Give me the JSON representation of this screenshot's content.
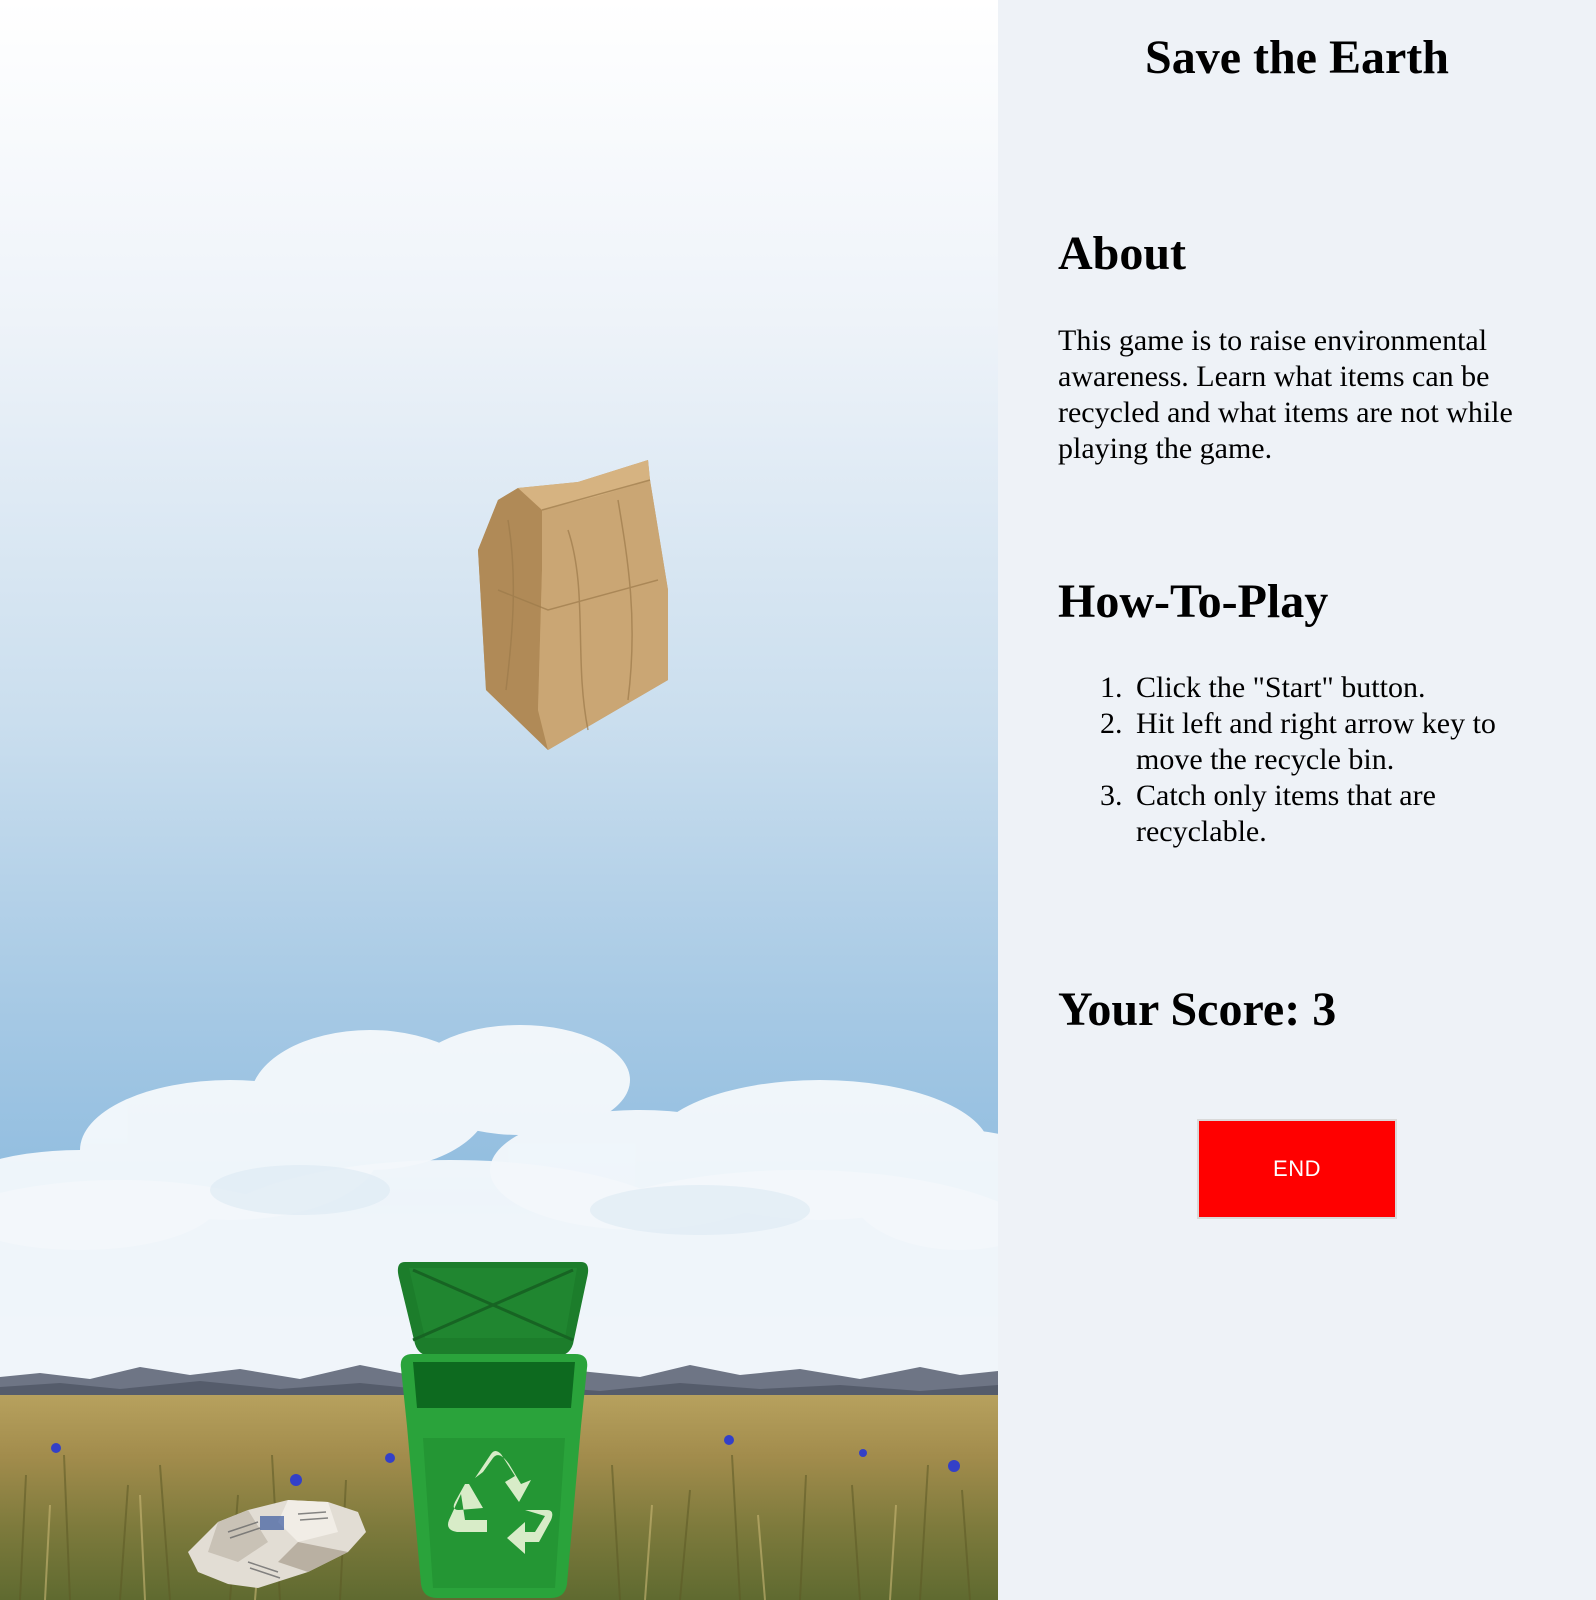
{
  "sidebar": {
    "title": "Save the Earth",
    "about_heading": "About",
    "about_text": "This game is to raise environmental awareness. Learn what items can be recycled and what items are not while playing the game.",
    "howto_heading": "How-To-Play",
    "steps": [
      {
        "num": "1.",
        "text": "Click the \"Start\" button."
      },
      {
        "num": "2.",
        "text": "Hit left and right arrow key to move the recycle bin."
      },
      {
        "num": "3.",
        "text": "Catch only items that are recyclable."
      }
    ],
    "score_label": "Your Score: 3",
    "end_label": "END"
  },
  "game": {
    "falling_item": "paper-bag",
    "ground_item": "crumpled-newspaper",
    "player": "recycle-bin",
    "player_icon": "recycle-icon"
  },
  "colors": {
    "end_button": "#ff0000",
    "bin_green": "#1f8f2e",
    "sidebar_bg": "#eef2f7"
  }
}
